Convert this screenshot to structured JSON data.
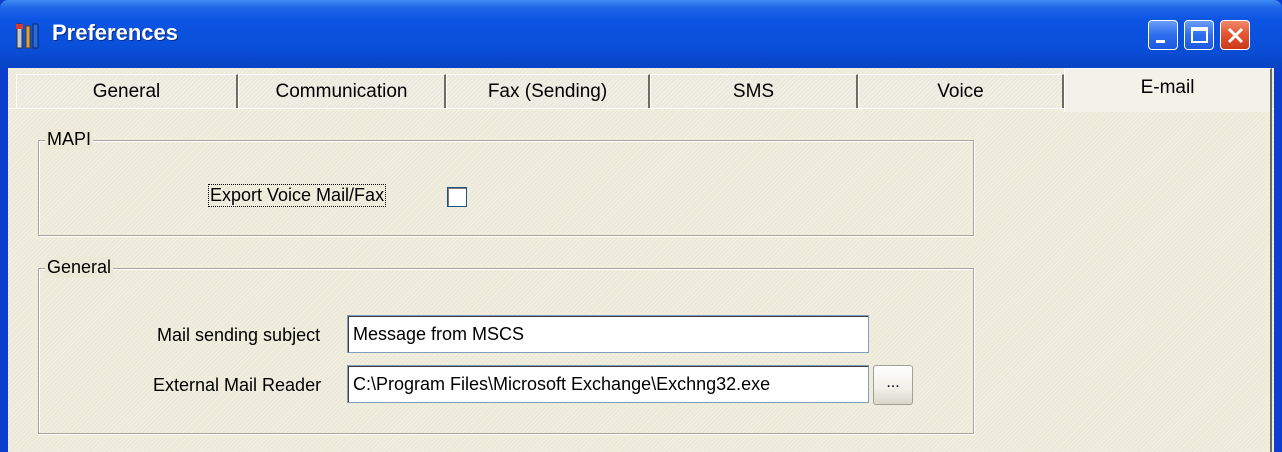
{
  "window": {
    "title": "Preferences"
  },
  "tabs": [
    {
      "label": "General",
      "active": false
    },
    {
      "label": "Communication",
      "active": false
    },
    {
      "label": "Fax (Sending)",
      "active": false
    },
    {
      "label": "SMS",
      "active": false
    },
    {
      "label": "Voice",
      "active": false
    },
    {
      "label": "E-mail",
      "active": true
    }
  ],
  "mapi_group": {
    "title": "MAPI",
    "export_label": "Export Voice Mail/Fax",
    "export_checked": false
  },
  "general_group": {
    "title": "General",
    "subject_label": "Mail sending subject",
    "subject_value": "Message from MSCS",
    "reader_label": "External Mail Reader",
    "reader_value": "C:\\Program Files\\Microsoft Exchange\\Exchng32.exe",
    "browse_label": "..."
  },
  "icons": {
    "app": "tools-icon",
    "minimize": "minimize-icon",
    "maximize": "maximize-icon",
    "close": "close-icon"
  },
  "colors": {
    "titlebar": "#0b54e3",
    "client_bg": "#ece9d8",
    "close_button": "#e2532f"
  }
}
